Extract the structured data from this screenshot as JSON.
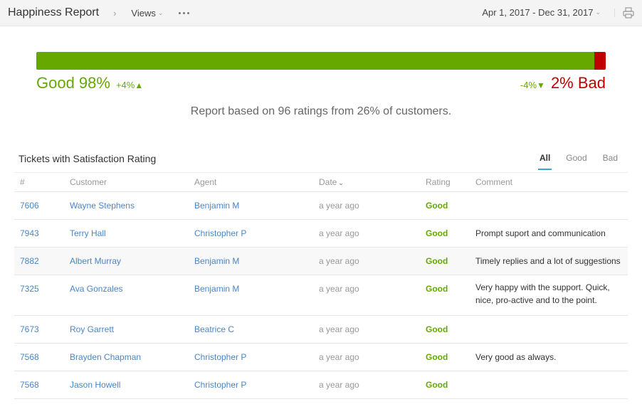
{
  "header": {
    "title": "Happiness Report",
    "views_label": "Views",
    "date_range": "Apr 1, 2017 - Dec 31, 2017",
    "icons": {
      "breadcrumb": "chevron-right-icon",
      "more": "more-dots-icon",
      "print": "printer-icon"
    }
  },
  "summary": {
    "good_percent": 98,
    "bad_percent": 2,
    "good_label": "Good 98%",
    "good_delta": "+4%",
    "bad_label": "2% Bad",
    "bad_delta": "-4%",
    "good_color": "#66a800",
    "bad_color": "#c00000",
    "report_text": "Report based on 96 ratings from 26% of customers."
  },
  "tickets": {
    "title": "Tickets with Satisfaction Rating",
    "tabs": [
      {
        "label": "All",
        "active": true
      },
      {
        "label": "Good",
        "active": false
      },
      {
        "label": "Bad",
        "active": false
      }
    ],
    "columns": [
      "#",
      "Customer",
      "Agent",
      "Date",
      "Rating",
      "Comment"
    ],
    "rows": [
      {
        "id": "7606",
        "customer": "Wayne Stephens",
        "agent": "Benjamin M",
        "date": "a year ago",
        "rating": "Good",
        "comment": ""
      },
      {
        "id": "7943",
        "customer": "Terry Hall",
        "agent": "Christopher P",
        "date": "a year ago",
        "rating": "Good",
        "comment": "Prompt suport and communication"
      },
      {
        "id": "7882",
        "customer": "Albert Murray",
        "agent": "Benjamin M",
        "date": "a year ago",
        "rating": "Good",
        "comment": "Timely replies and a lot of suggestions"
      },
      {
        "id": "7325",
        "customer": "Ava Gonzales",
        "agent": "Benjamin M",
        "date": "a year ago",
        "rating": "Good",
        "comment": "Very happy with the support. Quick, nice, pro-active and to the point."
      },
      {
        "id": "7673",
        "customer": "Roy Garrett",
        "agent": "Beatrice C",
        "date": "a year ago",
        "rating": "Good",
        "comment": ""
      },
      {
        "id": "7568",
        "customer": "Brayden Chapman",
        "agent": "Christopher P",
        "date": "a year ago",
        "rating": "Good",
        "comment": "Very good as always."
      },
      {
        "id": "7568",
        "customer": "Jason Howell",
        "agent": "Christopher P",
        "date": "a year ago",
        "rating": "Good",
        "comment": ""
      }
    ]
  }
}
